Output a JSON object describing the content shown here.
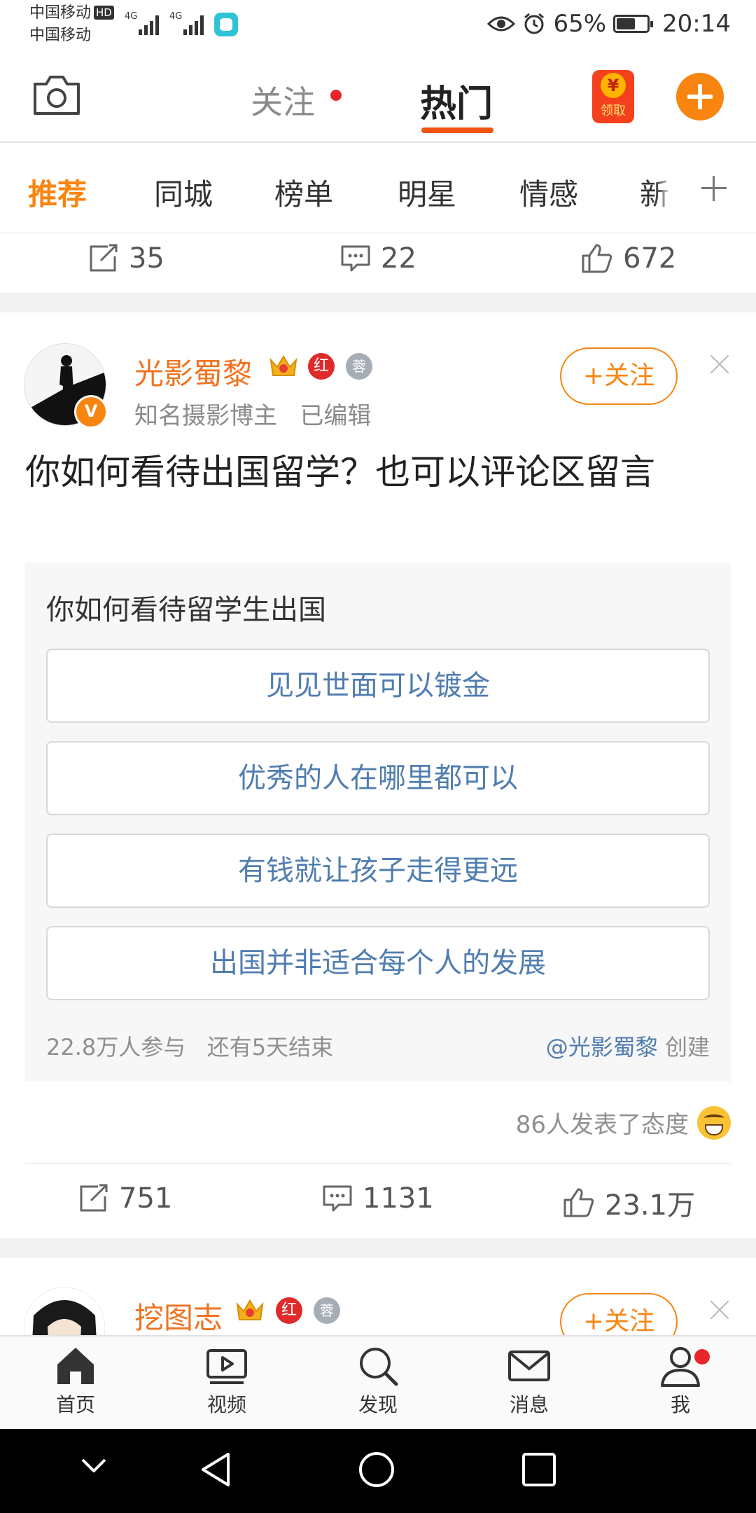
{
  "status_bar": {
    "carrier1": "中国移动",
    "carrier2": "中国移动",
    "hd": "HD",
    "net1": "4G",
    "net2": "4G",
    "battery_pct": "65%",
    "battery_level": 0.65,
    "time": "20:14"
  },
  "top_nav": {
    "tab_follow": "关注",
    "tab_hot": "热门",
    "red_packet_label": "领取",
    "red_packet_symbol": "¥"
  },
  "categories": [
    "推荐",
    "同城",
    "榜单",
    "明星",
    "情感",
    "新"
  ],
  "prev_post_actions": {
    "repost": "35",
    "comment": "22",
    "like": "672"
  },
  "post": {
    "user_name": "光影蜀黎",
    "badge_red": "红",
    "badge_silver": "蓉",
    "verified": "V",
    "user_sub": "知名摄影博主   已编辑",
    "follow_label": "+关注",
    "text": "你如何看待出国留学？也可以评论区留言",
    "vote": {
      "question": "你如何看待留学生出国",
      "options": [
        "见见世面可以镀金",
        "优秀的人在哪里都可以",
        "有钱就让孩子走得更远",
        "出国并非适合每个人的发展"
      ],
      "participants": "22.8万人参与   还有5天结束",
      "creator": "@光影蜀黎",
      "creator_suffix": " 创建"
    },
    "attitude": "86人发表了态度",
    "actions": {
      "repost": "751",
      "comment": "1131",
      "like": "23.1万"
    }
  },
  "next_post": {
    "user_name": "挖图志",
    "badge_red": "红",
    "badge_silver": "蓉",
    "follow_label": "+关注"
  },
  "tab_bar": {
    "home": "首页",
    "video": "视频",
    "discover": "发现",
    "messages": "消息",
    "me": "我"
  },
  "colors": {
    "accent": "#f98511",
    "hot_underline": "#f45410",
    "link": "#507daf",
    "badge_red": "#e02a2a"
  }
}
